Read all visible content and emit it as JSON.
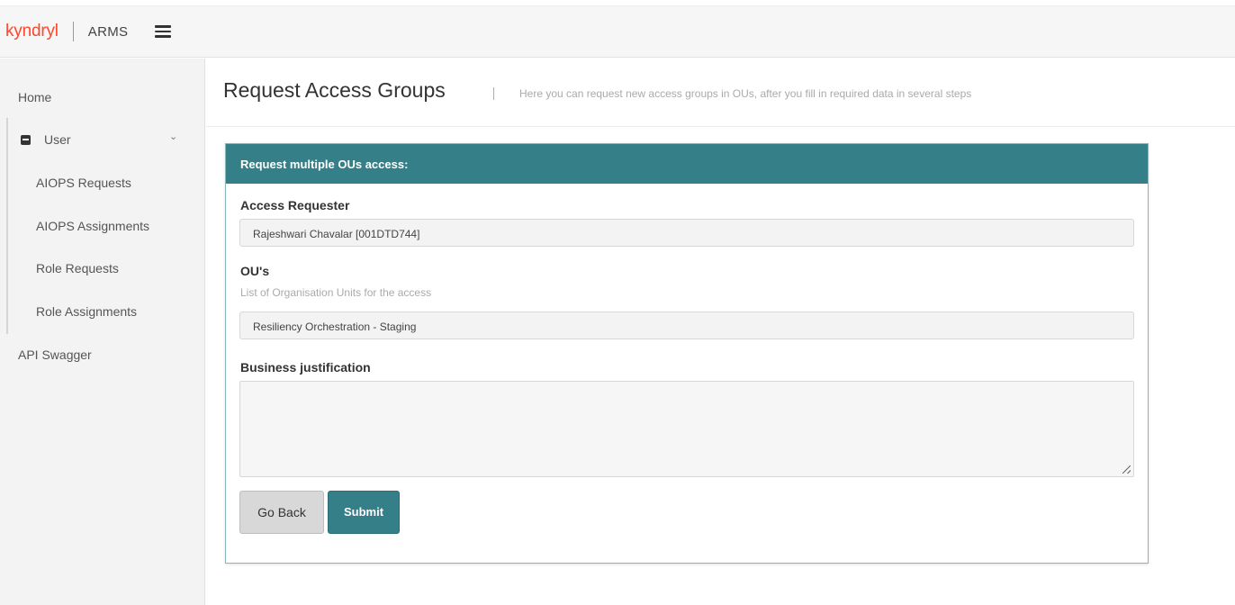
{
  "header": {
    "brand": "kyndryl",
    "app_name": "ARMS"
  },
  "sidebar": {
    "home": "Home",
    "user": "User",
    "items": [
      "AIOPS Requests",
      "AIOPS Assignments",
      "Role Requests",
      "Role Assignments"
    ],
    "api": "API Swagger"
  },
  "page": {
    "title": "Request Access Groups",
    "subtitle": "Here you can request new access groups in OUs, after you fill in required data in several steps"
  },
  "card": {
    "title": "Request multiple OUs access:",
    "requester_label": "Access Requester",
    "requester_value": "Rajeshwari Chavalar [001DTD744]",
    "ou_label": "OU's",
    "ou_hint": "List of Organisation Units for the access",
    "ou_value": "Resiliency Orchestration - Staging",
    "justification_label": "Business justification",
    "justification_value": "",
    "back_label": "Go Back",
    "submit_label": "Submit"
  },
  "colors": {
    "brand": "#ff462d",
    "accent": "#357f88"
  }
}
